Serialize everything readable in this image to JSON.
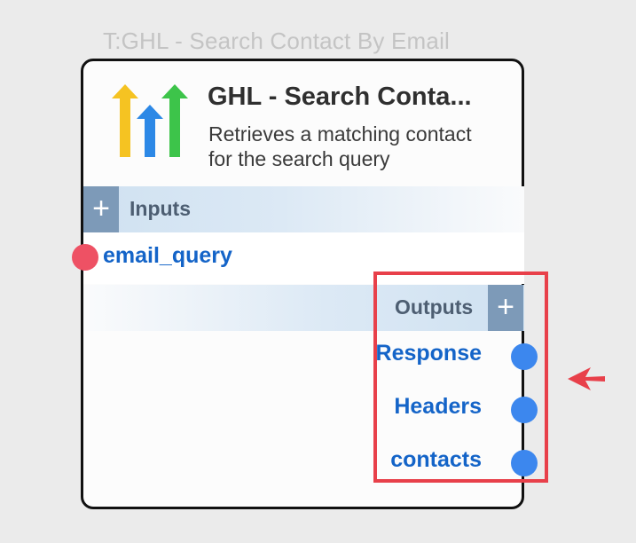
{
  "node": {
    "caption": "T:GHL - Search Contact By Email",
    "title": "GHL - Search Conta...",
    "description": "Retrieves a matching contact for the search query",
    "logo_icon": "highlevel-arrows-logo",
    "inputs": {
      "label": "Inputs",
      "add_icon": "+",
      "ports": [
        {
          "name": "email_query"
        }
      ]
    },
    "outputs": {
      "label": "Outputs",
      "add_icon": "+",
      "ports": [
        {
          "name": "Response"
        },
        {
          "name": "Headers"
        },
        {
          "name": "contacts"
        }
      ]
    }
  },
  "colors": {
    "input_port": "#ee5164",
    "output_port": "#3c87ee",
    "port_label": "#1464c8",
    "highlight": "#e8404a",
    "section_button": "#7d9ab8"
  }
}
